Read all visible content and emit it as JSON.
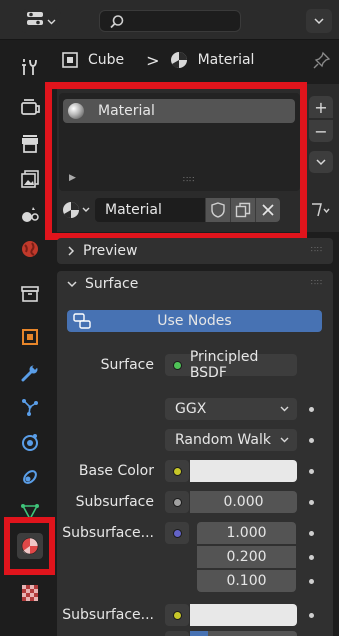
{
  "header": {
    "editor_icon": "properties-editor-icon",
    "search_icon": "search-icon",
    "options_icon": "chevron-down-icon"
  },
  "tabs": [
    {
      "name": "tool",
      "icon": "tool-icon"
    },
    {
      "name": "render",
      "icon": "render-icon"
    },
    {
      "name": "output",
      "icon": "output-icon"
    },
    {
      "name": "view-layer",
      "icon": "view-layer-icon"
    },
    {
      "name": "scene",
      "icon": "scene-icon"
    },
    {
      "name": "world",
      "icon": "world-icon"
    },
    {
      "name": "collection",
      "icon": "collection-icon"
    },
    {
      "name": "object",
      "icon": "object-icon"
    },
    {
      "name": "modifiers",
      "icon": "wrench-icon"
    },
    {
      "name": "particles",
      "icon": "particles-icon"
    },
    {
      "name": "physics",
      "icon": "physics-icon"
    },
    {
      "name": "constraints",
      "icon": "constraints-icon"
    },
    {
      "name": "data",
      "icon": "mesh-data-icon"
    },
    {
      "name": "material",
      "icon": "material-icon",
      "active": true
    },
    {
      "name": "texture",
      "icon": "texture-icon"
    }
  ],
  "breadcrumb": {
    "object": "Cube",
    "separator": ">",
    "material": "Material"
  },
  "slots": {
    "items": [
      {
        "label": "Material"
      }
    ],
    "add_label": "+",
    "remove_label": "−"
  },
  "material_selector": {
    "name": "Material"
  },
  "panels": {
    "preview": {
      "title": "Preview",
      "expanded": false
    },
    "surface": {
      "title": "Surface",
      "expanded": true
    }
  },
  "surface": {
    "use_nodes_label": "Use Nodes",
    "surface_label": "Surface",
    "surface_value": "Principled BSDF",
    "distribution": "GGX",
    "subsurface_method": "Random Walk",
    "base_color_label": "Base Color",
    "subsurface_label": "Subsurface",
    "subsurface_value": "0.000",
    "subsurface_radius_label": "Subsurface...",
    "subsurface_radius": [
      "1.000",
      "0.200",
      "0.100"
    ],
    "subsurface_color_label": "Subsurface..."
  },
  "colors": {
    "highlight": "#e0141c",
    "accent_blue": "#4772b3",
    "socket_shader": "#4fc257",
    "socket_color": "#c7c729",
    "socket_float": "#a1a1a1",
    "socket_vector": "#6363c7"
  }
}
